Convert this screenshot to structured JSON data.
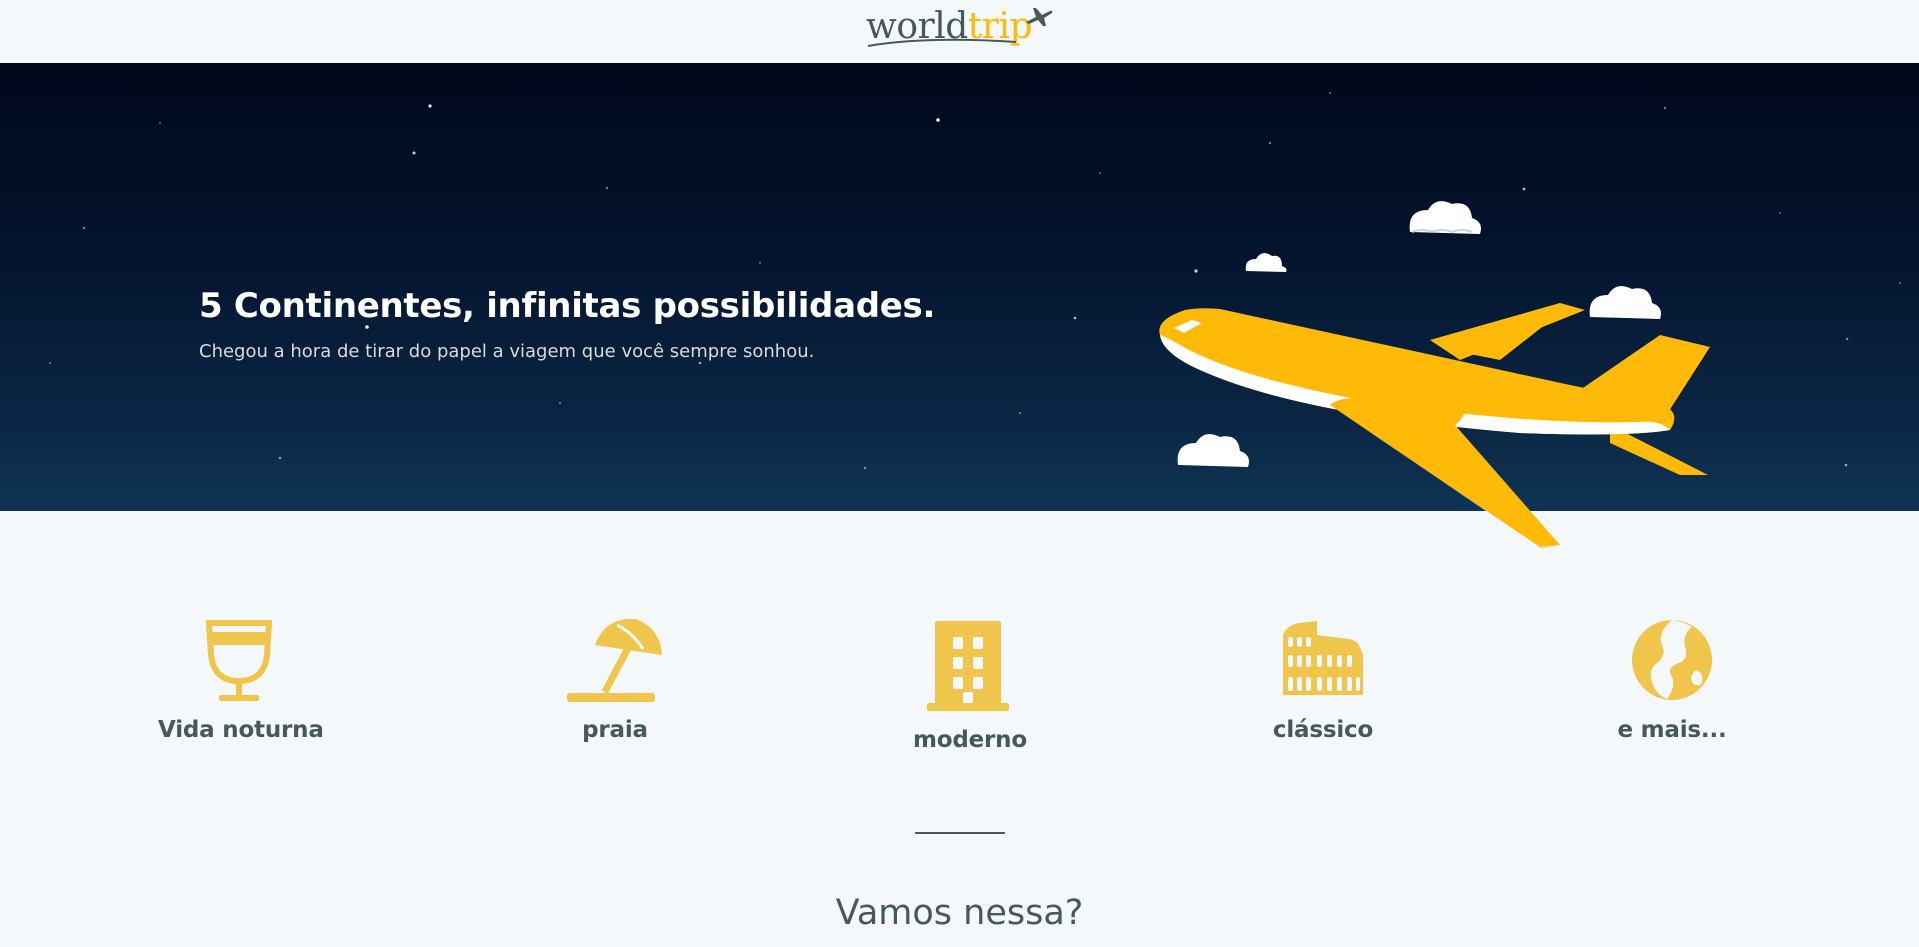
{
  "header": {
    "logo": {
      "word_world": "world",
      "word_trip": "trip",
      "icon": "airplane-icon"
    }
  },
  "banner": {
    "title": "5 Continentes, infinitas possibilidades.",
    "subtitle": "Chegou a hora de tirar do papel a viagem que você sempre sonhou.",
    "illustration": "airplane-with-clouds"
  },
  "categories": [
    {
      "label": "Vida noturna",
      "icon": "cocktail-glass-icon"
    },
    {
      "label": "praia",
      "icon": "beach-umbrella-icon"
    },
    {
      "label": "moderno",
      "icon": "building-icon"
    },
    {
      "label": "clássico",
      "icon": "colosseum-icon"
    },
    {
      "label": "e mais...",
      "icon": "earth-globe-icon"
    }
  ],
  "cta": {
    "title": "Vamos nessa?"
  },
  "colors": {
    "accent": "#ffba08",
    "icon_yellow": "#f0c54c",
    "text_dark": "#47585b",
    "background": "#f5f8fa",
    "banner_dark": "#00071a"
  }
}
